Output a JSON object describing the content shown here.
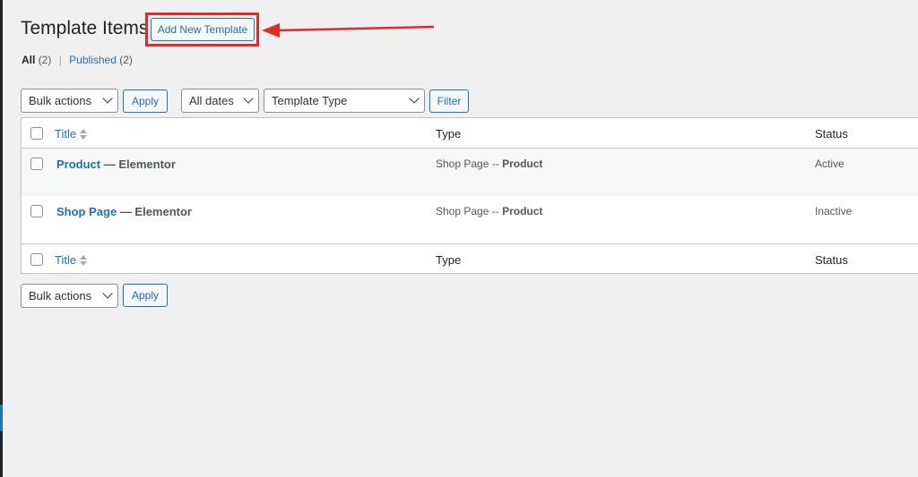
{
  "page": {
    "title": "Template Items",
    "add_new_label": "Add New Template"
  },
  "views": {
    "all_label": "All",
    "all_count": "(2)",
    "separator": "|",
    "published_label": "Published",
    "published_count": "(2)"
  },
  "filters": {
    "bulk_actions": "Bulk actions",
    "apply_label": "Apply",
    "dates": "All dates",
    "template_type": "Template Type",
    "filter_label": "Filter"
  },
  "table": {
    "columns": {
      "title": "Title",
      "type": "Type",
      "status": "Status"
    },
    "rows": [
      {
        "title": "Product",
        "state": "— Elementor",
        "type_prefix": "Shop Page --",
        "type_name": "Product",
        "status": "Active"
      },
      {
        "title": "Shop Page",
        "state": "— Elementor",
        "type_prefix": "Shop Page --",
        "type_name": "Product",
        "status": "Inactive"
      }
    ]
  },
  "bottom": {
    "bulk_actions": "Bulk actions",
    "apply_label": "Apply"
  },
  "colors": {
    "accent": "#2271b1",
    "highlight": "#e02b27",
    "background": "#f0f0f1"
  },
  "icons": {
    "sort": "sort-arrows-icon",
    "dropdown": "chevron-down-icon",
    "annotation": "red-arrow-icon"
  }
}
